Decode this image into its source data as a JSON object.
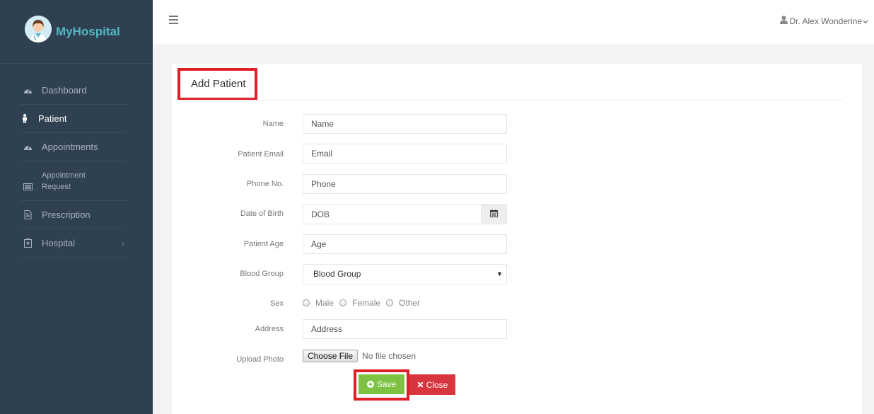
{
  "brand": {
    "name": "MyHospital",
    "logo_icon": "doctor-avatar-icon"
  },
  "sidebar": {
    "items": [
      {
        "label": "Dashboard",
        "icon": "dashboard-icon"
      },
      {
        "label": "Patient",
        "icon": "person-icon",
        "active": true
      },
      {
        "label": "Appointments",
        "icon": "dashboard-icon"
      },
      {
        "label_line1": "Appointment",
        "label_line2": "Request",
        "icon": "list-icon"
      },
      {
        "label": "Prescription",
        "icon": "file-icon"
      },
      {
        "label": "Hospital",
        "icon": "hospital-icon",
        "has_children": true
      }
    ]
  },
  "topbar": {
    "menu_icon": "hamburger-icon",
    "user_name": "Dr. Alex Wonderine"
  },
  "form": {
    "title": "Add Patient",
    "fields": {
      "name": {
        "label": "Name",
        "placeholder": "Name"
      },
      "email": {
        "label": "Patient Email",
        "placeholder": "Email"
      },
      "phone": {
        "label": "Phone No.",
        "placeholder": "Phone"
      },
      "dob": {
        "label": "Date of Birth",
        "placeholder": "DOB"
      },
      "age": {
        "label": "Patient Age",
        "placeholder": "Age"
      },
      "blood_group": {
        "label": "Blood Group",
        "selected": "Blood Group"
      },
      "sex": {
        "label": "Sex",
        "options": [
          "Male",
          "Female",
          "Other"
        ]
      },
      "address": {
        "label": "Address",
        "placeholder": "Address"
      },
      "photo": {
        "label": "Upload Photo",
        "button": "Choose File",
        "status": "No file chosen"
      }
    },
    "save_label": "Save",
    "close_label": "Close"
  },
  "colors": {
    "sidebar": "#2f4050",
    "brand_text": "#52b8c6",
    "save": "#7dc242",
    "close": "#d9353e",
    "highlight": "#e01f26"
  }
}
